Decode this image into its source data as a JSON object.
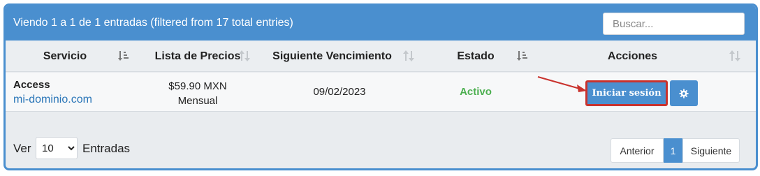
{
  "header": {
    "info": "Viendo 1 a 1 de 1 entradas (filtered from 17 total entries)",
    "search_placeholder": "Buscar..."
  },
  "columns": [
    {
      "label": "Servicio",
      "sort": "ascending"
    },
    {
      "label": "Lista de Precios",
      "sort": "unsorted"
    },
    {
      "label": "Siguiente Vencimiento",
      "sort": "unsorted"
    },
    {
      "label": "Estado",
      "sort": "ascending"
    },
    {
      "label": "Acciones",
      "sort": "unsorted"
    }
  ],
  "rows": [
    {
      "service_name": "Access",
      "service_domain": "mi-dominio.com",
      "price": "$59.90 MXN",
      "cycle": "Mensual",
      "next_due": "09/02/2023",
      "status": "Activo",
      "login_label": "Iniciar sesión",
      "settings_icon": "gear-icon"
    }
  ],
  "footer": {
    "show_label": "Ver",
    "page_size": "10",
    "page_size_options": [
      "10"
    ],
    "entries_label": "Entradas"
  },
  "pagination": {
    "prev": "Anterior",
    "current": "1",
    "next": "Siguiente"
  },
  "colors": {
    "accent": "#4a8fcf",
    "status_active": "#4caf50",
    "highlight": "#c9322d",
    "link": "#2a76b8"
  }
}
